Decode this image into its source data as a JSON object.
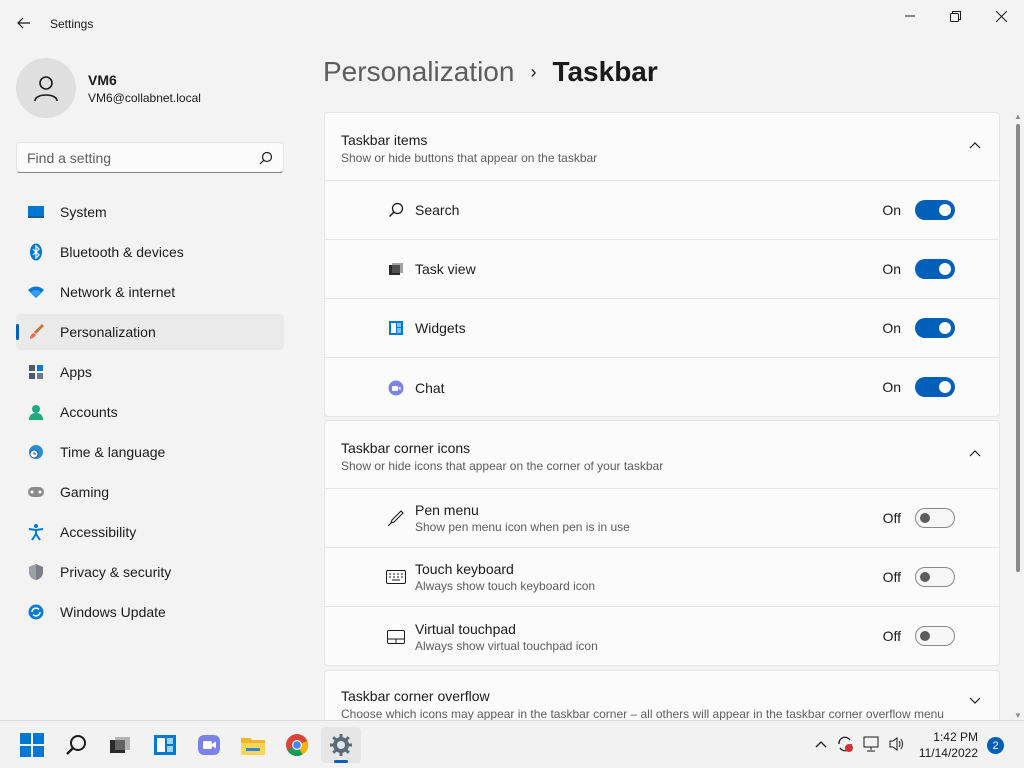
{
  "window": {
    "title": "Settings"
  },
  "profile": {
    "name": "VM6",
    "email": "VM6@collabnet.local"
  },
  "search": {
    "placeholder": "Find a setting"
  },
  "sidebar": {
    "items": [
      {
        "label": "System",
        "icon": "system-icon"
      },
      {
        "label": "Bluetooth & devices",
        "icon": "bluetooth-icon"
      },
      {
        "label": "Network & internet",
        "icon": "wifi-icon"
      },
      {
        "label": "Personalization",
        "icon": "brush-icon",
        "active": true
      },
      {
        "label": "Apps",
        "icon": "apps-icon"
      },
      {
        "label": "Accounts",
        "icon": "person-icon"
      },
      {
        "label": "Time & language",
        "icon": "globe-clock-icon"
      },
      {
        "label": "Gaming",
        "icon": "gamepad-icon"
      },
      {
        "label": "Accessibility",
        "icon": "accessibility-icon"
      },
      {
        "label": "Privacy & security",
        "icon": "shield-icon"
      },
      {
        "label": "Windows Update",
        "icon": "update-icon"
      }
    ]
  },
  "breadcrumb": {
    "parent": "Personalization",
    "separator": "›",
    "current": "Taskbar"
  },
  "sections": {
    "taskbar_items": {
      "title": "Taskbar items",
      "subtitle": "Show or hide buttons that appear on the taskbar",
      "rows": [
        {
          "label": "Search",
          "state": "On",
          "icon": "search-icon"
        },
        {
          "label": "Task view",
          "state": "On",
          "icon": "task-view-icon"
        },
        {
          "label": "Widgets",
          "state": "On",
          "icon": "widgets-icon"
        },
        {
          "label": "Chat",
          "state": "On",
          "icon": "chat-icon"
        }
      ]
    },
    "corner_icons": {
      "title": "Taskbar corner icons",
      "subtitle": "Show or hide icons that appear on the corner of your taskbar",
      "rows": [
        {
          "label": "Pen menu",
          "desc": "Show pen menu icon when pen is in use",
          "state": "Off",
          "icon": "pen-icon"
        },
        {
          "label": "Touch keyboard",
          "desc": "Always show touch keyboard icon",
          "state": "Off",
          "icon": "keyboard-icon"
        },
        {
          "label": "Virtual touchpad",
          "desc": "Always show virtual touchpad icon",
          "state": "Off",
          "icon": "touchpad-icon"
        }
      ]
    },
    "corner_overflow": {
      "title": "Taskbar corner overflow",
      "subtitle": "Choose which icons may appear in the taskbar corner – all others will appear in the taskbar corner overflow menu"
    }
  },
  "taskbar": {
    "time": "1:42 PM",
    "date": "11/14/2022",
    "notifications": "2"
  },
  "colors": {
    "accent": "#005fb8",
    "background": "#f3f3f3",
    "card": "#fbfbfb"
  }
}
